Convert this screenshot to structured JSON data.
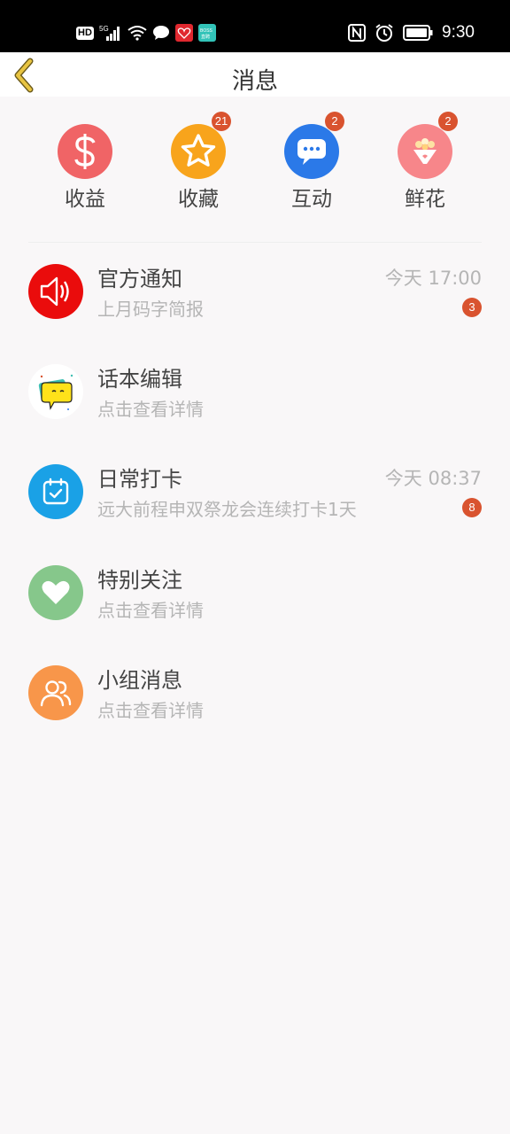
{
  "status_bar": {
    "left_icons": [
      "hd-icon",
      "5g-signal-icon",
      "wifi-icon",
      "chat-bubble-icon",
      "app-heart-icon",
      "app-boss-icon"
    ],
    "hd_label": "HD",
    "right_icons": [
      "nfc-icon",
      "alarm-icon",
      "battery-icon"
    ],
    "time": "9:30"
  },
  "header": {
    "title": "消息"
  },
  "categories": [
    {
      "label": "收益",
      "icon": "dollar-icon",
      "color": "#f06466",
      "badge": ""
    },
    {
      "label": "收藏",
      "icon": "star-icon",
      "color": "#f8a41c",
      "badge": "21"
    },
    {
      "label": "互动",
      "icon": "chat-icon",
      "color": "#2b79e8",
      "badge": "2"
    },
    {
      "label": "鲜花",
      "icon": "flower-bouquet-icon",
      "color": "#f7868a",
      "badge": "2"
    }
  ],
  "messages": [
    {
      "title": "官方通知",
      "subtitle": "上月码字简报",
      "time": "今天 17:00",
      "badge": "3",
      "icon": "speaker-icon",
      "color": "#ea0c0c"
    },
    {
      "title": "话本编辑",
      "subtitle": "点击查看详情",
      "time": "",
      "badge": "",
      "icon": "editor-avatar-icon",
      "color": "#ffffff"
    },
    {
      "title": "日常打卡",
      "subtitle": "远大前程申双祭龙会连续打卡1天",
      "time": "今天 08:37",
      "badge": "8",
      "icon": "calendar-check-icon",
      "color": "#1aa1e6"
    },
    {
      "title": "特别关注",
      "subtitle": "点击查看详情",
      "time": "",
      "badge": "",
      "icon": "heart-icon",
      "color": "#86c78b"
    },
    {
      "title": "小组消息",
      "subtitle": "点击查看详情",
      "time": "",
      "badge": "",
      "icon": "group-users-icon",
      "color": "#f8964a"
    }
  ],
  "colors": {
    "badge": "#d9532f",
    "background": "#f9f7f8",
    "back_arrow": "#c9a227"
  }
}
